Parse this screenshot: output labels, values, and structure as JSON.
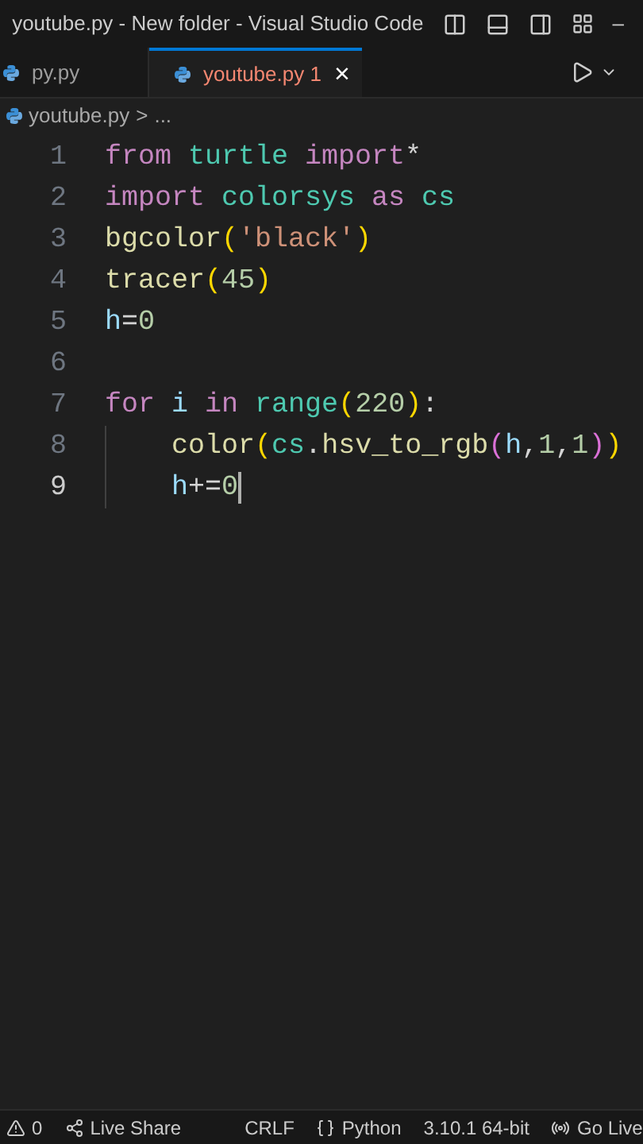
{
  "window": {
    "title": "youtube.py - New folder - Visual Studio Code",
    "minimize": "–"
  },
  "tabs": [
    {
      "label": "py.py",
      "selected": false
    },
    {
      "label": "youtube.py",
      "problems": "1",
      "close": "×",
      "selected": true
    }
  ],
  "breadcrumb": {
    "file": "youtube.py",
    "separator": ">",
    "more": "..."
  },
  "editor": {
    "lines": [
      {
        "number": "1",
        "active": false,
        "tokens": [
          {
            "kind": "keyword",
            "text": "from"
          },
          {
            "kind": "module",
            "text": " turtle"
          },
          {
            "kind": "keyword",
            "text": " import"
          },
          {
            "kind": "plain",
            "text": "*"
          }
        ]
      },
      {
        "number": "2",
        "active": false,
        "tokens": [
          {
            "kind": "keyword",
            "text": "import"
          },
          {
            "kind": "module",
            "text": " colorsys"
          },
          {
            "kind": "keyword",
            "text": " as"
          },
          {
            "kind": "module",
            "text": " cs"
          }
        ]
      },
      {
        "number": "3",
        "active": false,
        "tokens": [
          {
            "kind": "function",
            "text": "bgcolor"
          },
          {
            "kind": "bracket1",
            "text": "("
          },
          {
            "kind": "string",
            "text": "'black'"
          },
          {
            "kind": "bracket1",
            "text": ")"
          }
        ]
      },
      {
        "number": "4",
        "active": false,
        "tokens": [
          {
            "kind": "function",
            "text": "tracer"
          },
          {
            "kind": "bracket1",
            "text": "("
          },
          {
            "kind": "number",
            "text": "45"
          },
          {
            "kind": "bracket1",
            "text": ")"
          }
        ]
      },
      {
        "number": "5",
        "active": false,
        "tokens": [
          {
            "kind": "variable",
            "text": "h"
          },
          {
            "kind": "plain",
            "text": "="
          },
          {
            "kind": "number",
            "text": "0"
          }
        ]
      },
      {
        "number": "6",
        "active": false
      },
      {
        "number": "7",
        "active": false,
        "tokens": [
          {
            "kind": "keyword",
            "text": "for"
          },
          {
            "kind": "variable",
            "text": " i"
          },
          {
            "kind": "keyword",
            "text": " in"
          },
          {
            "kind": "module",
            "text": " range"
          },
          {
            "kind": "bracket1",
            "text": "("
          },
          {
            "kind": "number",
            "text": "220"
          },
          {
            "kind": "bracket1",
            "text": ")"
          },
          {
            "kind": "plain",
            "text": ":"
          }
        ]
      },
      {
        "number": "8",
        "active": false,
        "indent": true,
        "tokens": [
          {
            "kind": "function",
            "text": "color"
          },
          {
            "kind": "bracket1",
            "text": "("
          },
          {
            "kind": "module",
            "text": "cs"
          },
          {
            "kind": "plain",
            "text": "."
          },
          {
            "kind": "function",
            "text": "hsv_to_rgb"
          },
          {
            "kind": "bracket2",
            "text": "("
          },
          {
            "kind": "variable",
            "text": "h"
          },
          {
            "kind": "plain",
            "text": ","
          },
          {
            "kind": "number",
            "text": "1"
          },
          {
            "kind": "plain",
            "text": ","
          },
          {
            "kind": "number",
            "text": "1"
          },
          {
            "kind": "bracket2",
            "text": ")"
          },
          {
            "kind": "bracket1",
            "text": ")"
          }
        ]
      },
      {
        "number": "9",
        "active": true,
        "indent": true,
        "tokens": [
          {
            "kind": "variable",
            "text": "h"
          },
          {
            "kind": "plain",
            "text": "+="
          },
          {
            "kind": "number",
            "text": "0"
          }
        ]
      }
    ]
  },
  "status_bar": {
    "problems": "0",
    "live_share": "Live Share",
    "line_ending": "CRLF",
    "language": "Python",
    "interpreter": "3.10.1 64-bit",
    "go_live": "Go Live"
  }
}
